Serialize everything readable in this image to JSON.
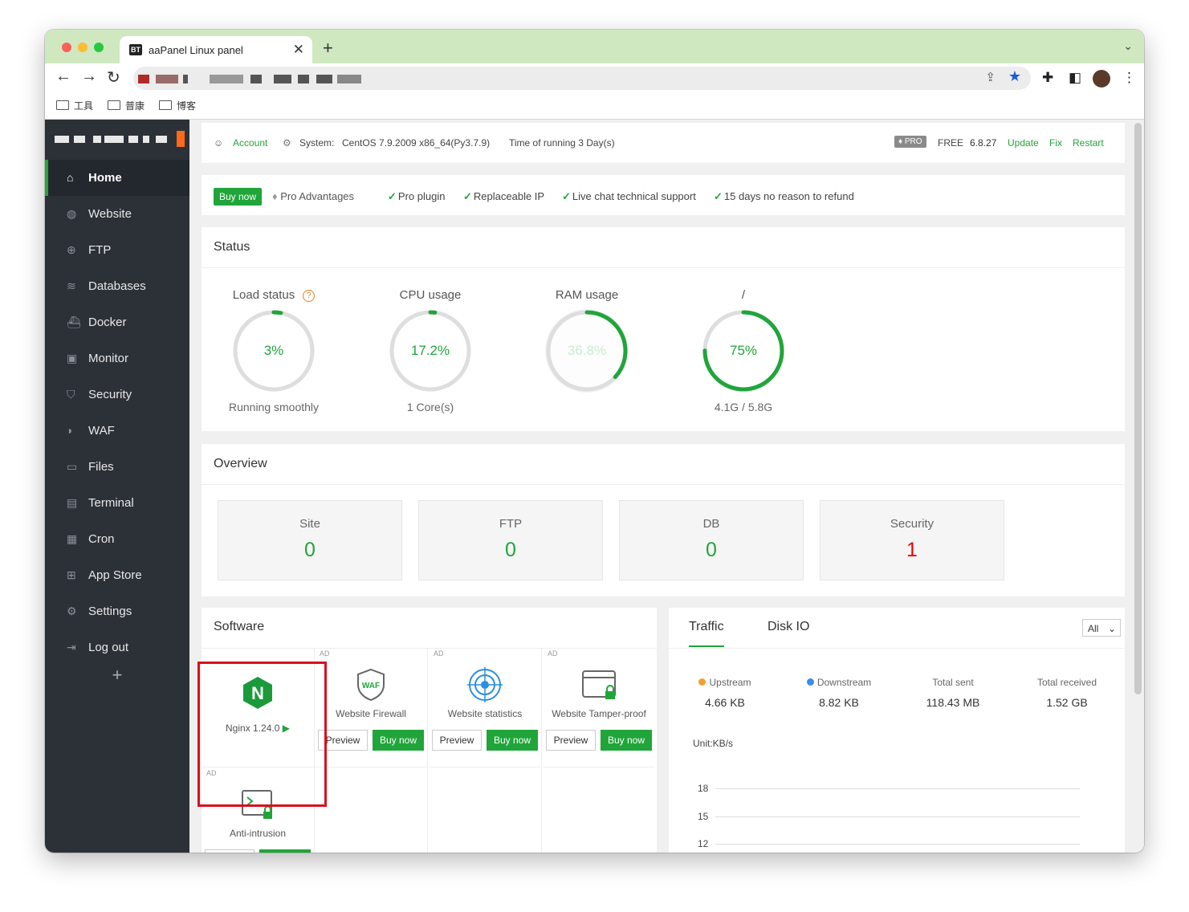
{
  "browser": {
    "tab_favicon": "BT",
    "tab_title": "aaPanel Linux panel",
    "bookmarks": [
      "工具",
      "普康",
      "博客"
    ],
    "icons": [
      "back-icon",
      "forward-icon",
      "reload-icon",
      "share-icon",
      "star-icon",
      "extensions-icon",
      "sidepanel-icon",
      "menu-icon"
    ]
  },
  "sidebar": {
    "items": [
      {
        "label": "Home",
        "icon": "home-icon"
      },
      {
        "label": "Website",
        "icon": "globe-icon"
      },
      {
        "label": "FTP",
        "icon": "ftp-icon"
      },
      {
        "label": "Databases",
        "icon": "database-icon"
      },
      {
        "label": "Docker",
        "icon": "docker-icon"
      },
      {
        "label": "Monitor",
        "icon": "monitor-icon"
      },
      {
        "label": "Security",
        "icon": "shield-icon"
      },
      {
        "label": "WAF",
        "icon": "waf-icon"
      },
      {
        "label": "Files",
        "icon": "folder-icon"
      },
      {
        "label": "Terminal",
        "icon": "terminal-icon"
      },
      {
        "label": "Cron",
        "icon": "calendar-icon"
      },
      {
        "label": "App Store",
        "icon": "apps-icon"
      },
      {
        "label": "Settings",
        "icon": "gear-icon"
      },
      {
        "label": "Log out",
        "icon": "logout-icon"
      }
    ],
    "add_label": "+"
  },
  "topbar": {
    "account": "Account",
    "system_label": "System:",
    "system_value": "CentOS 7.9.2009 x86_64(Py3.7.9)",
    "uptime": "Time of running 3 Day(s)",
    "pro_badge": "PRO",
    "plan": "FREE",
    "version": "6.8.27",
    "update": "Update",
    "fix": "Fix",
    "restart": "Restart"
  },
  "buybar": {
    "buy_now": "Buy now",
    "pro_advantages": "Pro Advantages",
    "features": [
      "Pro plugin",
      "Replaceable IP",
      "Live chat technical support",
      "15 days no reason to refund"
    ]
  },
  "status": {
    "title": "Status",
    "gauges": [
      {
        "label": "Load status",
        "value": "3%",
        "sub": "Running smoothly",
        "percent": 3
      },
      {
        "label": "CPU usage",
        "value": "17.2%",
        "sub": "1 Core(s)",
        "percent": 2
      },
      {
        "label": "RAM usage",
        "value": "36.8%",
        "sub": "",
        "percent": 36.8
      },
      {
        "label": "/",
        "value": "75%",
        "sub": "4.1G / 5.8G",
        "percent": 75
      }
    ]
  },
  "overview": {
    "title": "Overview",
    "boxes": [
      {
        "label": "Site",
        "value": "0"
      },
      {
        "label": "FTP",
        "value": "0"
      },
      {
        "label": "DB",
        "value": "0"
      },
      {
        "label": "Security",
        "value": "1"
      }
    ]
  },
  "software": {
    "title": "Software",
    "ad_tag": "AD",
    "preview": "Preview",
    "buy_now": "Buy now",
    "items": [
      {
        "name": "Nginx 1.24.0",
        "icon": "nginx-icon"
      },
      {
        "name": "Website Firewall",
        "icon": "waf-shield-icon",
        "icon_text": "WAF"
      },
      {
        "name": "Website statistics",
        "icon": "radar-icon"
      },
      {
        "name": "Website Tamper-proof",
        "icon": "browser-lock-icon"
      },
      {
        "name": "Anti-intrusion",
        "icon": "terminal-lock-icon"
      }
    ]
  },
  "traffic": {
    "tabs": [
      "Traffic",
      "Disk IO"
    ],
    "select": "All",
    "stats": [
      {
        "label": "Upstream",
        "value": "4.66 KB",
        "color": "#f0a030"
      },
      {
        "label": "Downstream",
        "value": "8.82 KB",
        "color": "#3a8ee6"
      },
      {
        "label": "Total sent",
        "value": "118.43 MB"
      },
      {
        "label": "Total received",
        "value": "1.52 GB"
      }
    ],
    "unit": "Unit:KB/s",
    "yticks": [
      "18",
      "15",
      "12"
    ]
  },
  "colors": {
    "accent": "#20a53a",
    "sidebar": "#2c3138",
    "danger": "#e00000"
  }
}
